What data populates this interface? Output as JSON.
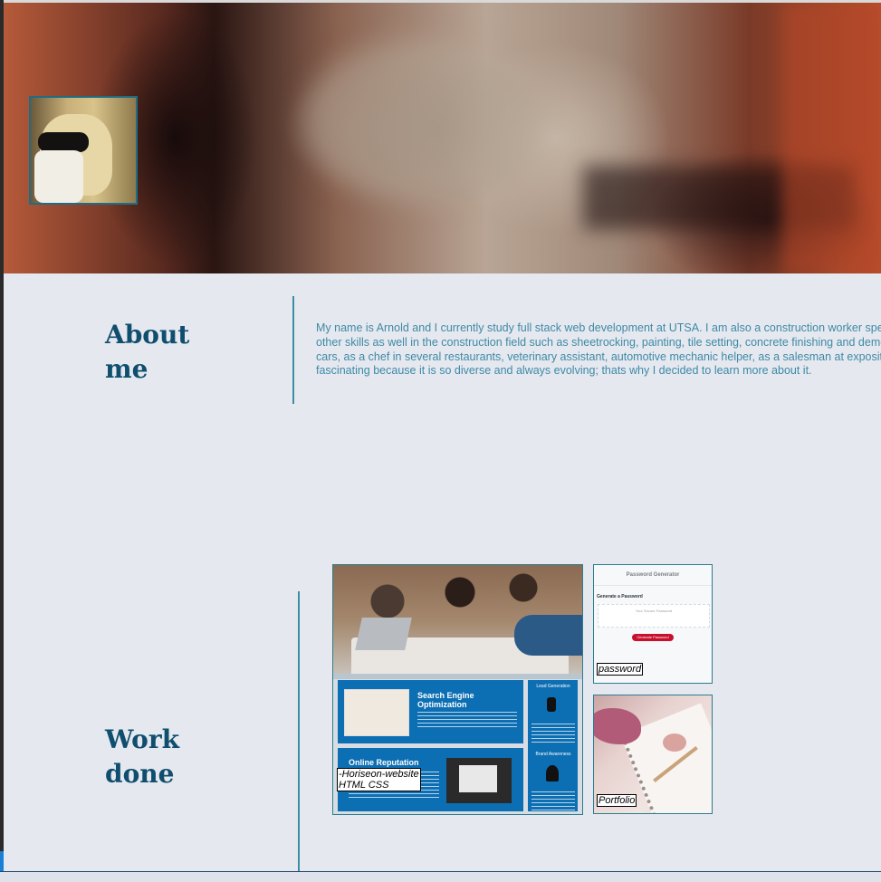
{
  "about": {
    "title_line1": "About",
    "title_line2": "me",
    "text_lines": [
      "My name is Arnold and I currently study full stack web development at UTSA. I am also a construction worker speciali",
      "other skills as well in the construction field such as sheetrocking, painting, tile setting, concrete finishing and demolitio",
      "cars, as a chef in several restaurants, veterinary assistant, automotive mechanic helper, as a salesman at expositions",
      "fascinating because it is so diverse and always evolving; thats why I decided to learn more about it."
    ]
  },
  "work": {
    "title_line1": "Work",
    "title_line2": "done",
    "projects": [
      {
        "label_line1": "-Horiseon-website",
        "label_line2": "HTML CSS",
        "thumb": {
          "heading1_line1": "Search Engine",
          "heading1_line2": "Optimization",
          "heading2": "Online Reputation",
          "side1": "Lead Generation",
          "side2": "Brand Awareness"
        }
      },
      {
        "label": "password",
        "thumb": {
          "title": "Password Generator",
          "subtitle": "Generate a Password",
          "placeholder": "Your Secure Password",
          "button": "Generate Password"
        }
      },
      {
        "label": "Portfolio"
      }
    ]
  },
  "colors": {
    "page_bg": "#e6e8ef",
    "heading": "#0f4e6e",
    "body_text": "#3d8aa6",
    "divider": "#3b8ea5",
    "accent_blue": "#0c6eb3"
  }
}
